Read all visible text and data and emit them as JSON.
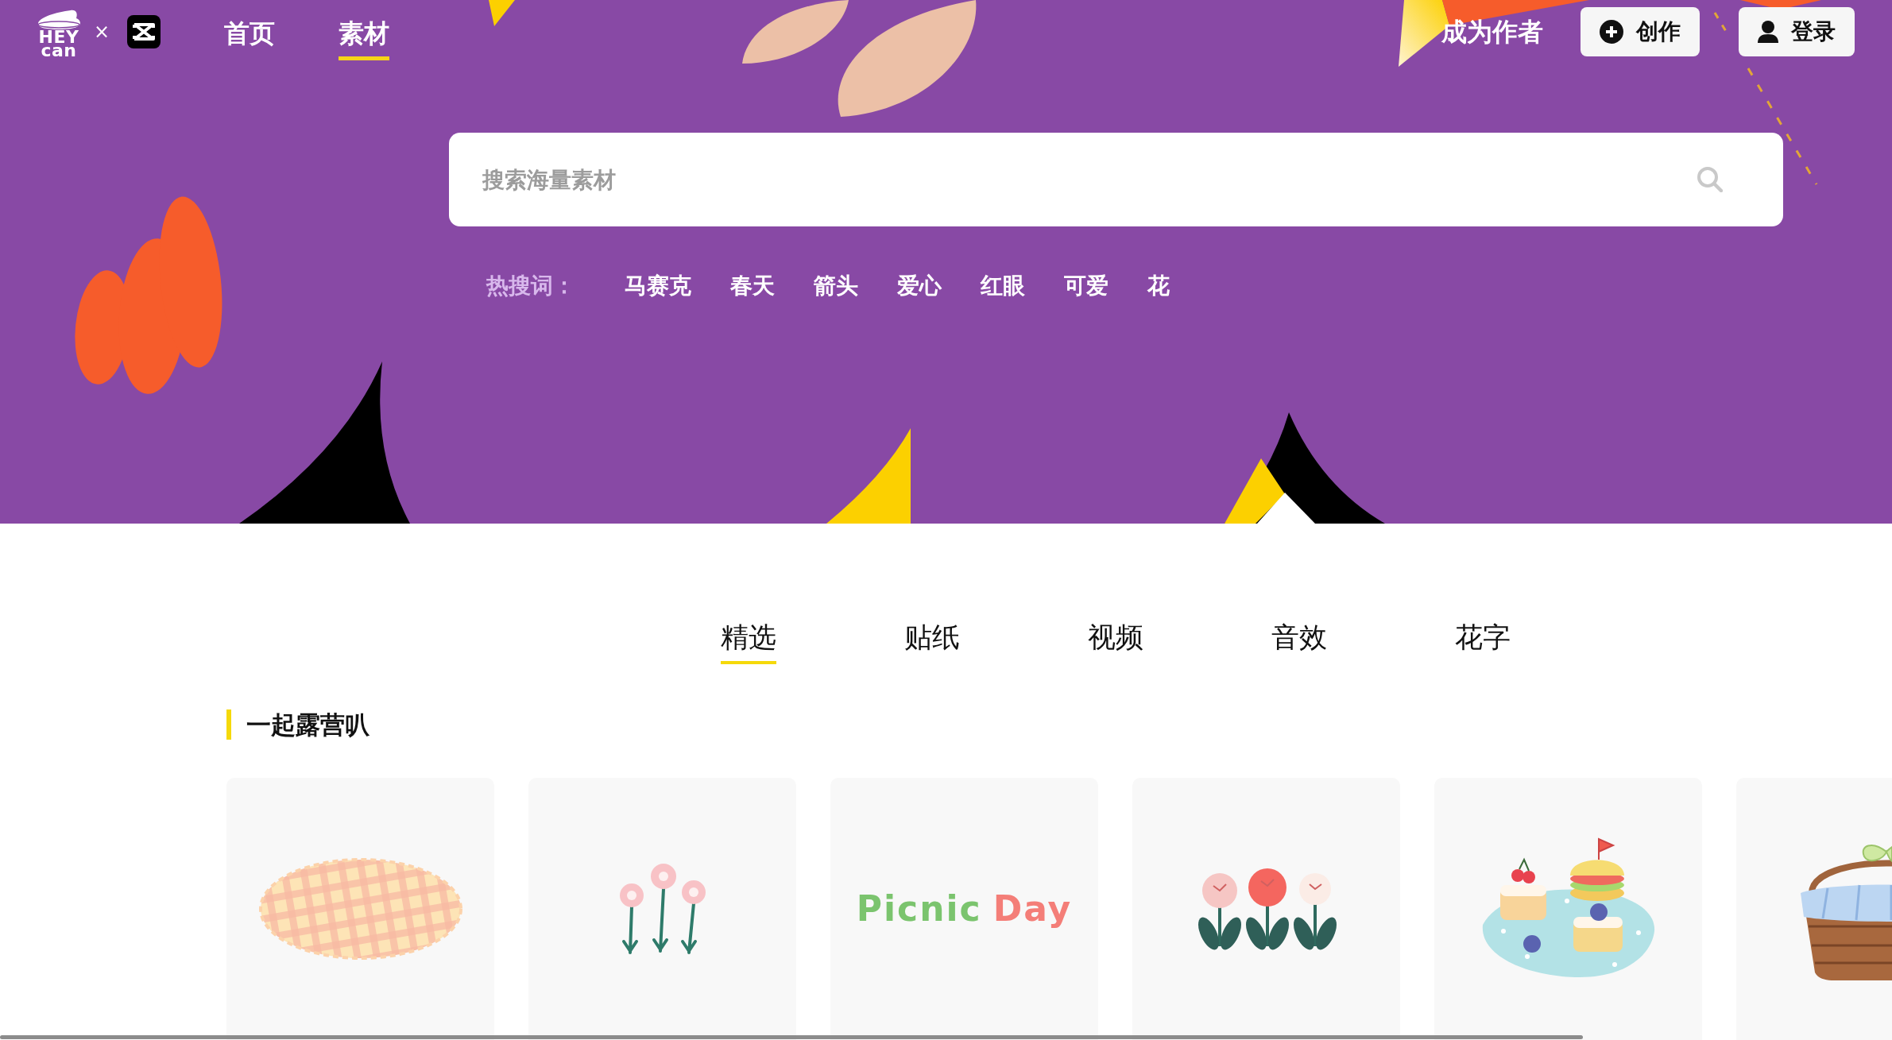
{
  "header": {
    "logo": {
      "lines": [
        "HEY",
        "can"
      ]
    },
    "separator": "×",
    "nav": [
      {
        "label": "首页",
        "selected": false
      },
      {
        "label": "素材",
        "selected": true
      }
    ],
    "author_link": "成为作者",
    "buttons": [
      {
        "kind": "create",
        "label": "创作"
      },
      {
        "kind": "login",
        "label": "登录"
      }
    ]
  },
  "search": {
    "placeholder": "搜索海量素材"
  },
  "hot_searches": {
    "label": "热搜词：",
    "terms": [
      "马赛克",
      "春天",
      "箭头",
      "爱心",
      "红眼",
      "可爱",
      "花"
    ]
  },
  "tabs": [
    {
      "label": "精选",
      "selected": true
    },
    {
      "label": "贴纸",
      "selected": false
    },
    {
      "label": "视频",
      "selected": false
    },
    {
      "label": "音效",
      "selected": false
    },
    {
      "label": "花字",
      "selected": false
    }
  ],
  "sections": [
    {
      "title": "一起露营叭",
      "items": [
        {
          "kind": "blanket"
        },
        {
          "kind": "flowers"
        },
        {
          "kind": "lettering",
          "words": [
            {
              "text": "Picnic",
              "color": "#7bc46e"
            },
            {
              "text": "Day",
              "color": "#f47e78"
            }
          ]
        },
        {
          "kind": "tulips"
        },
        {
          "kind": "cakes"
        },
        {
          "kind": "basket"
        }
      ]
    }
  ]
}
